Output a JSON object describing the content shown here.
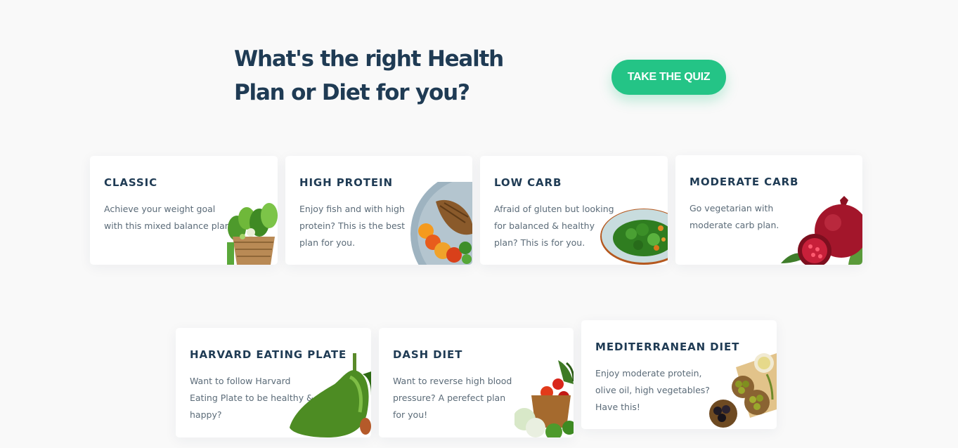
{
  "hero": {
    "title_line1": "What's the right Health",
    "title_line2": "Plan or Diet for you?",
    "cta_label": "TAKE THE QUIZ"
  },
  "colors": {
    "accent": "#24c486",
    "heading": "#1f3b54",
    "body_text": "#5b6b78",
    "background": "#f9f9f9",
    "card": "#ffffff"
  },
  "plans": [
    {
      "title": "CLASSIC",
      "description": "Achieve your weight goal with this mixed balance plan",
      "image": "vegetable-basket-icon"
    },
    {
      "title": "HIGH PROTEIN",
      "description": "Enjoy fish and with high protein? This is the best plan for you.",
      "image": "grilled-fish-plate-icon"
    },
    {
      "title": "LOW CARB",
      "description": "Afraid of gluten but looking for balanced & healthy plan? This is for you.",
      "image": "greens-bowl-icon"
    },
    {
      "title": "MODERATE CARB",
      "description": "Go vegetarian with moderate carb plan.",
      "image": "pomegranate-icon"
    },
    {
      "title": "HARVARD EATING PLATE",
      "description": "Want to follow Harvard Eating Plate to be healthy & happy?",
      "image": "avocado-icon"
    },
    {
      "title": "DASH DIET",
      "description": "Want to reverse high blood pressure? A perefect plan for you!",
      "image": "vegetable-basket-icon"
    },
    {
      "title": "MEDITERRANEAN DIET",
      "description": "Enjoy moderate protein, olive oil, high vegetables? Have this!",
      "image": "olives-board-icon"
    }
  ]
}
